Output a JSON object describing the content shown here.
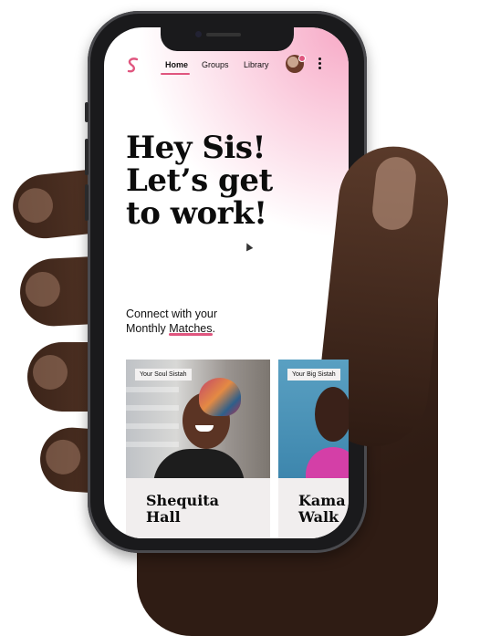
{
  "app": {
    "logo_letter": "S",
    "brand_color": "#e0567f",
    "accent_pink": "#f7a9c6"
  },
  "nav": {
    "items": [
      {
        "label": "Home",
        "active": true
      },
      {
        "label": "Groups",
        "active": false
      },
      {
        "label": "Library",
        "active": false
      }
    ],
    "avatar_icon": "user-avatar",
    "menu_icon": "kebab-menu-icon"
  },
  "hero": {
    "line1": "Hey Sis!",
    "line2": "Let’s get",
    "line3": "to work!"
  },
  "intro": {
    "text_before": "Connect with your",
    "text_line2_before": "Monthly ",
    "highlight": "Matches",
    "text_after": "."
  },
  "matches": [
    {
      "tag": "Your Soul Sistah",
      "first_name": "Shequita",
      "last_name": "Hall"
    },
    {
      "tag": "Your Big Sistah",
      "first_name": "Kama",
      "last_name": "Walk"
    }
  ]
}
